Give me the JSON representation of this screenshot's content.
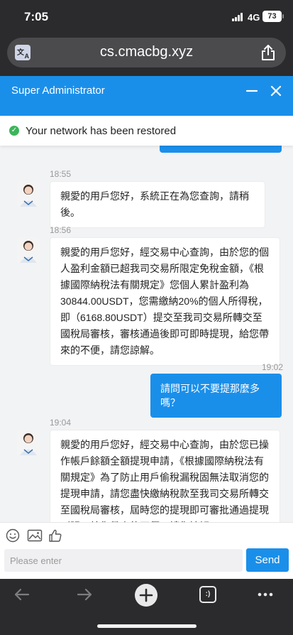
{
  "status_bar": {
    "time": "7:05",
    "network": "4G",
    "battery": "73"
  },
  "browser": {
    "url": "cs.cmacbg.xyz"
  },
  "header": {
    "title": "Super Administrator"
  },
  "notice": {
    "text": "Your network has been restored"
  },
  "messages": [
    {
      "direction": "incoming",
      "time": "18:55",
      "text": "親愛的用戶您好，系統正在為您查詢，請稍後。"
    },
    {
      "direction": "incoming",
      "time": "18:56",
      "text": "親愛的用戶您好，經交易中心查詢，由於您的個人盈利金額已超我司交易所限定免稅金額，《根據國際納稅法有關規定》您個人累計盈利為30844.00USDT，您需繳納20%的個人所得稅，即（6168.80USDT）提交至我司交易所轉交至國稅局審核，審核通過後即可即時提現，給您帶來的不便，請您諒解。"
    },
    {
      "direction": "outgoing",
      "time": "19:02",
      "text": "請問可以不要提那麼多嗎？"
    },
    {
      "direction": "incoming",
      "time": "19:04",
      "text": "親愛的用戶您好，經交易中心查詢，由於您已操作帳戶餘額全額提現申請，《根據國際納稅法有關規定》為了防止用戶偷稅漏稅固無法取消您的提現申請，請您盡快繳納稅款至我司交易所轉交至國稅局審核，屆時您的提現即可審批通過提現到賬，給您帶來的不便，請您諒解。"
    }
  ],
  "composer": {
    "placeholder": "Please enter",
    "send_label": "Send"
  },
  "icons": {
    "toolbar": [
      "emoji-icon",
      "image-icon",
      "thumbs-up-icon"
    ],
    "browser_nav": [
      "back-arrow-icon",
      "forward-arrow-icon",
      "new-tab-plus-icon",
      "tabs-icon",
      "more-icon"
    ]
  },
  "colors": {
    "accent": "#1a8fea",
    "success": "#3cb55a",
    "chrome": "#2b2b2d"
  }
}
